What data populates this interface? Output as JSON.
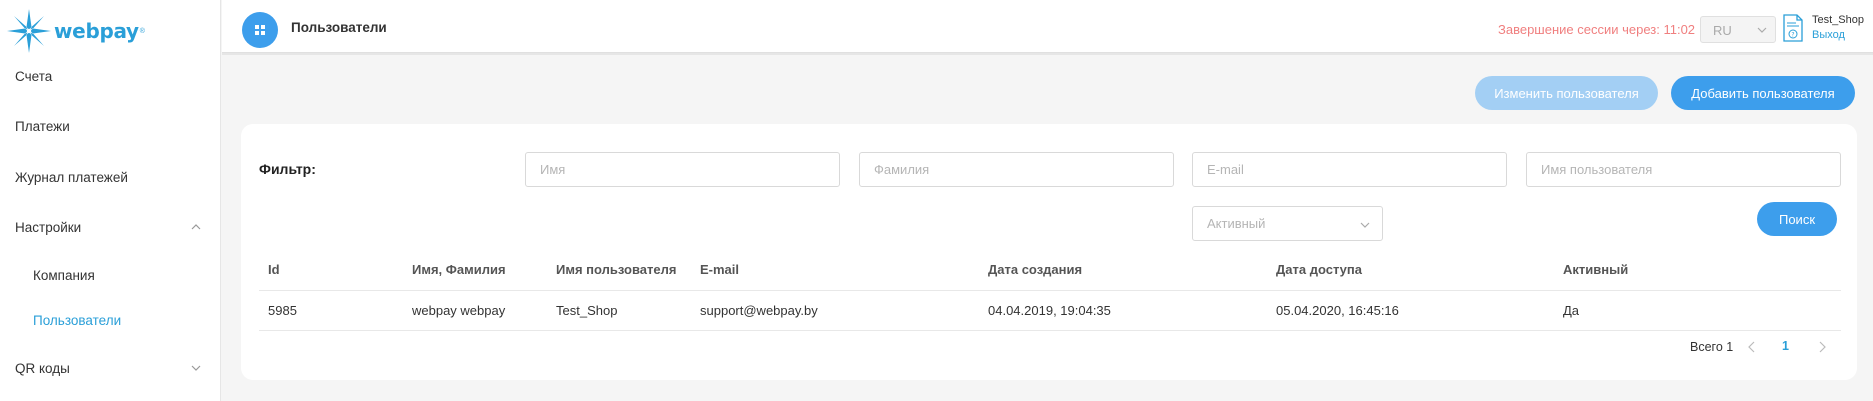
{
  "brand": {
    "name": "webpay",
    "mark": "®"
  },
  "sidebar": {
    "items": [
      {
        "label": "Счета"
      },
      {
        "label": "Платежи"
      },
      {
        "label": "Журнал платежей"
      },
      {
        "label": "Настройки"
      },
      {
        "label": "Компания"
      },
      {
        "label": "Пользователи"
      },
      {
        "label": "QR коды"
      }
    ]
  },
  "header": {
    "title": "Пользователи",
    "session": "Завершение сессии через: 11:02",
    "language": "RU",
    "user_name": "Test_Shop",
    "logout": "Выход"
  },
  "actions": {
    "edit_user": "Изменить пользователя",
    "add_user": "Добавить пользователя"
  },
  "filter": {
    "label": "Фильтр:",
    "first_name_placeholder": "Имя",
    "last_name_placeholder": "Фамилия",
    "email_placeholder": "E-mail",
    "username_placeholder": "Имя пользователя",
    "active_placeholder": "Активный",
    "search": "Поиск"
  },
  "table": {
    "columns": [
      "Id",
      "Имя, Фамилия",
      "Имя пользователя",
      "E-mail",
      "Дата создания",
      "Дата доступа",
      "Активный"
    ],
    "rows": [
      [
        "5985",
        "webpay webpay",
        "Test_Shop",
        "support@webpay.by",
        "04.04.2019, 19:04:35",
        "05.04.2020, 16:45:16",
        "Да"
      ]
    ]
  },
  "pagination": {
    "total": "Всего 1",
    "current": "1"
  },
  "colors": {
    "accent": "#3d9eec",
    "accent_light": "#a3cff4",
    "warning": "#f07f7f",
    "link": "#2a9fd8"
  }
}
